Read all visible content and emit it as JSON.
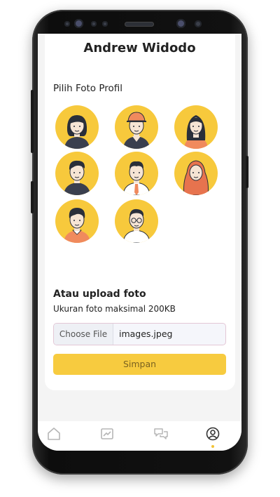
{
  "profile": {
    "name": "Andrew Widodo"
  },
  "avatar_picker": {
    "title": "Pilih Foto Profil",
    "avatars": [
      "avatar-woman-bob-icon",
      "avatar-man-cap-icon",
      "avatar-woman-long-hair-icon",
      "avatar-man-dark-hair-icon",
      "avatar-man-tie-icon",
      "avatar-woman-hijab-icon",
      "avatar-boy-icon",
      "avatar-man-glasses-icon"
    ]
  },
  "upload": {
    "title": "Atau upload foto",
    "note": "Ukuran foto maksimal 200KB",
    "choose_file_label": "Choose File",
    "file_name": "images.jpeg",
    "save_label": "Simpan"
  },
  "bottom_nav": {
    "items": [
      "home-icon",
      "chart-icon",
      "chat-icon",
      "profile-icon"
    ],
    "active": "profile-icon"
  },
  "colors": {
    "accent": "#f7cb3f",
    "avatar_bg": "#f7c93c",
    "text": "#222222"
  }
}
